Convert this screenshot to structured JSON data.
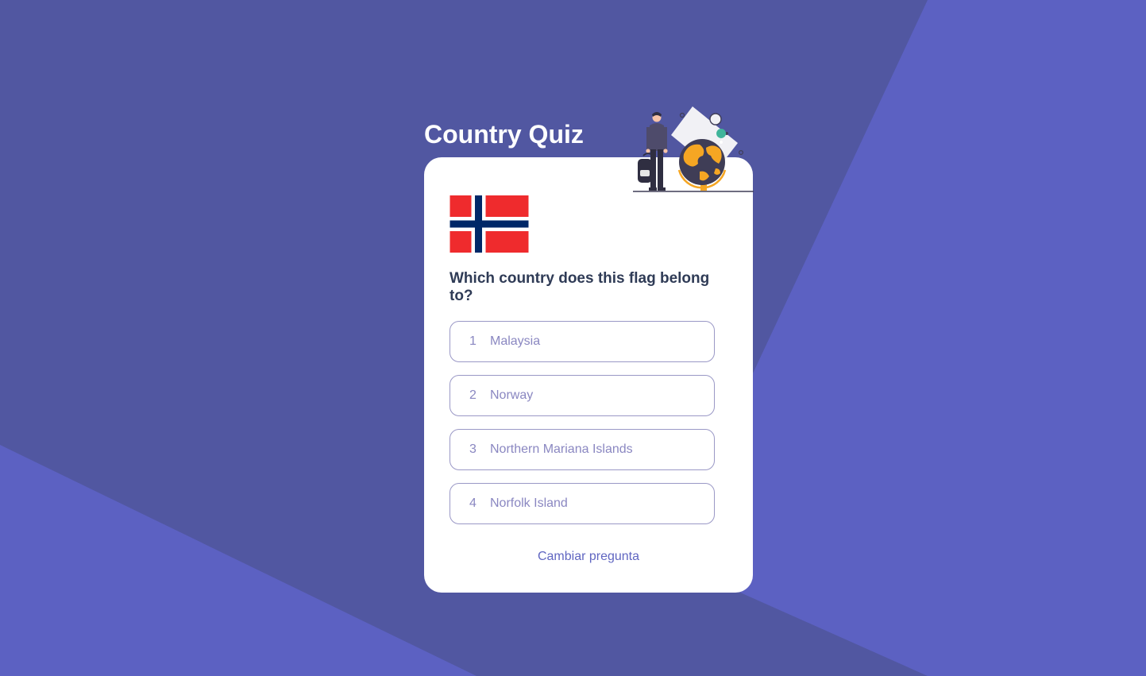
{
  "app": {
    "title": "Country Quiz"
  },
  "quiz": {
    "flag_icon": "norway-flag",
    "question": "Which country does this flag belong to?",
    "options": [
      {
        "number": "1",
        "label": "Malaysia"
      },
      {
        "number": "2",
        "label": "Norway"
      },
      {
        "number": "3",
        "label": "Northern Mariana Islands"
      },
      {
        "number": "4",
        "label": "Norfolk Island"
      }
    ],
    "change_question_label": "Cambiar pregunta"
  },
  "colors": {
    "background": "#5157a1",
    "background_accent": "#5c61c2",
    "card": "#ffffff",
    "option_border": "#9a98c6",
    "option_text": "#8a87c1",
    "question_text": "#2f3b56",
    "link_text": "#6066c1"
  }
}
